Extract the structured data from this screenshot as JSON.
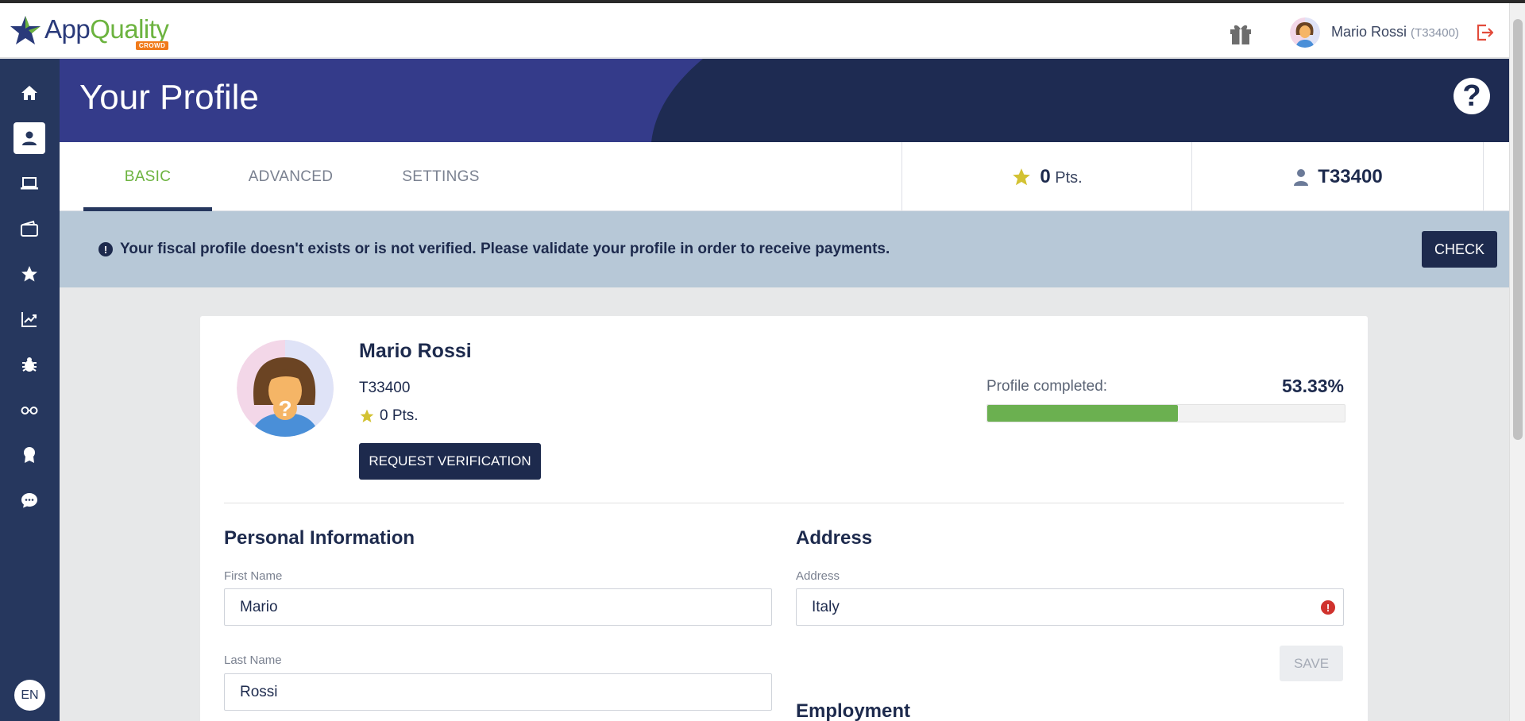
{
  "app": {
    "logo_app": "App",
    "logo_quality": "Quality",
    "logo_crowd": "CROWD",
    "brand_navy": "#1d2a4d",
    "brand_green": "#6cb33f"
  },
  "topbar": {
    "user_name": "Mario Rossi",
    "user_id": "(T33400)",
    "icons": [
      "gift-icon",
      "avatar",
      "logout-icon"
    ]
  },
  "sidebar": {
    "items": [
      {
        "icon": "home-icon",
        "active": false
      },
      {
        "icon": "profile-icon",
        "active": true
      },
      {
        "icon": "laptop-icon",
        "active": false
      },
      {
        "icon": "wallet-icon",
        "active": false
      },
      {
        "icon": "star-icon",
        "active": false
      },
      {
        "icon": "chart-icon",
        "active": false
      },
      {
        "icon": "bug-icon",
        "active": false
      },
      {
        "icon": "glasses-icon",
        "active": false
      },
      {
        "icon": "badge-icon",
        "active": false
      },
      {
        "icon": "chat-icon",
        "active": false
      }
    ],
    "language": "EN"
  },
  "header": {
    "title": "Your Profile",
    "help": "?"
  },
  "tabs": {
    "basic": "BASIC",
    "advanced": "ADVANCED",
    "settings": "SETTINGS",
    "active": "basic"
  },
  "stats": {
    "points_value": "0",
    "points_unit": "Pts.",
    "tester_id": "T33400"
  },
  "banner": {
    "message": "Your fiscal profile doesn't exists or is not verified. Please validate your profile in order to receive payments.",
    "check_label": "CHECK"
  },
  "profile": {
    "name": "Mario Rossi",
    "tester_id": "T33400",
    "points": "0 Pts.",
    "request_label": "REQUEST VERIFICATION",
    "completed_label": "Profile completed:",
    "completed_value": "53.33%",
    "completed_fraction": 0.5333
  },
  "personal": {
    "title": "Personal Information",
    "first_name_label": "First Name",
    "first_name_value": "Mario",
    "last_name_label": "Last Name",
    "last_name_value": "Rossi"
  },
  "address": {
    "title": "Address",
    "address_label": "Address",
    "address_value": "Italy",
    "save_label": "SAVE"
  },
  "employment": {
    "title": "Employment"
  }
}
